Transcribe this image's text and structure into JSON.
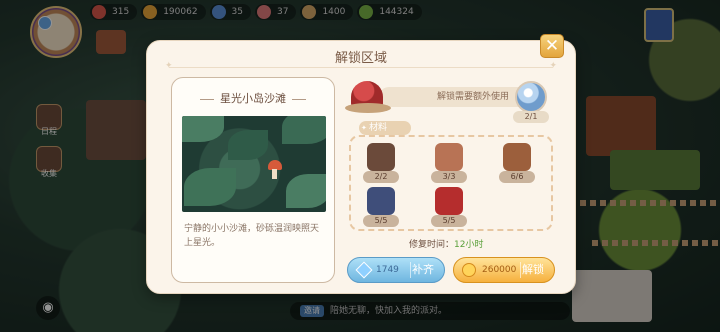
{
  "topbar": {
    "resources": [
      {
        "value": "315",
        "color": "#d9564a"
      },
      {
        "value": "190062",
        "color": "#e9a53a"
      },
      {
        "value": "35",
        "color": "#5a8fd8"
      },
      {
        "value": "37",
        "color": "#e07a7a"
      },
      {
        "value": "1400",
        "color": "#d8a968"
      },
      {
        "value": "144324",
        "color": "#7ab648"
      }
    ]
  },
  "side": {
    "btn1_label": "日程",
    "btn2_label": "收集"
  },
  "chat": {
    "tag": "邀请",
    "text": "陪她无聊，快加入我的派对。"
  },
  "dialog": {
    "title": "解锁区域",
    "close": "✕",
    "left": {
      "title": "星光小岛沙滩",
      "desc": "宁静的小小沙滩，砂砾温润映照天上星光。"
    },
    "extra_text": "解锁需要额外使用",
    "orb_count": "2/1",
    "materials_label": "材料",
    "materials": [
      {
        "name": "bookshelf-material",
        "count": "2/2",
        "color": "#6b4a3a"
      },
      {
        "name": "cake-material",
        "count": "3/3",
        "color": "#b87355"
      },
      {
        "name": "bowl-material",
        "count": "6/6",
        "color": "#9c5f3c"
      },
      {
        "name": "chest-material",
        "count": "5/5",
        "color": "#3f4e7a"
      },
      {
        "name": "bag-material",
        "count": "5/5",
        "color": "#b52d2d"
      }
    ],
    "repair_label": "修复时间：",
    "repair_value": "12小时",
    "refill_num": "1749",
    "refill_text": "补齐",
    "unlock_num": "260000",
    "unlock_text": "解锁"
  }
}
